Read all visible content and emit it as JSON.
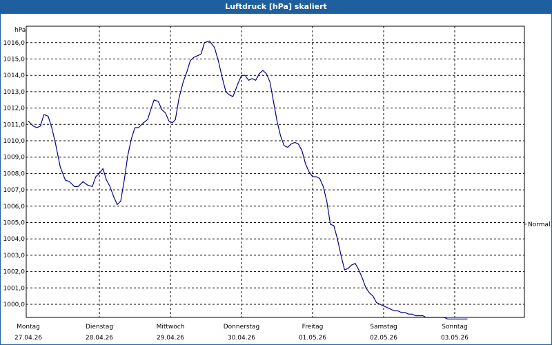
{
  "window": {
    "title": "Luftdruck [hPa] skaliert"
  },
  "chart_data": {
    "type": "line",
    "title": "Luftdruck [hPa] skaliert",
    "ylabel": "hPa",
    "xlabel": "",
    "ylim": [
      999.1,
      1016.6
    ],
    "xlim": [
      0,
      7
    ],
    "grid": true,
    "y_ticks": [
      "1000,0",
      "1001,0",
      "1002,0",
      "1003,0",
      "1004,0",
      "1005,0",
      "1006,0",
      "1007,0",
      "1008,0",
      "1009,0",
      "1010,0",
      "1011,0",
      "1012,0",
      "1013,0",
      "1014,0",
      "1015,0",
      "1016,0"
    ],
    "y_tick_values": [
      1000,
      1001,
      1002,
      1003,
      1004,
      1005,
      1006,
      1007,
      1008,
      1009,
      1010,
      1011,
      1012,
      1013,
      1014,
      1015,
      1016
    ],
    "x_ticks": [
      {
        "day": "Montag",
        "date": "27.04.26"
      },
      {
        "day": "Dienstag",
        "date": "28.04.26"
      },
      {
        "day": "Mittwoch",
        "date": "29.04.26"
      },
      {
        "day": "Donnerstag",
        "date": "30.04.26"
      },
      {
        "day": "Freitag",
        "date": "01.05.26"
      },
      {
        "day": "Samstag",
        "date": "02.05.26"
      },
      {
        "day": "Sonntag",
        "date": "03.05.26"
      }
    ],
    "reference_line": {
      "label": "Normal",
      "value": 1004.9
    },
    "colors": {
      "line": "#00008b",
      "grid": "#000000",
      "title_bar": "#1f5f9f"
    },
    "series": [
      {
        "x": [
          0.0,
          0.07,
          0.12,
          0.17,
          0.22,
          0.28,
          0.33,
          0.38,
          0.45,
          0.52,
          0.58,
          0.65,
          0.7,
          0.77,
          0.83,
          0.9,
          0.95,
          1.0,
          1.05,
          1.1,
          1.15,
          1.2,
          1.25,
          1.3,
          1.35,
          1.4,
          1.45,
          1.5,
          1.55,
          1.62,
          1.68,
          1.73,
          1.77,
          1.83,
          1.88,
          1.93,
          1.98,
          2.03,
          2.07,
          2.12,
          2.18,
          2.23,
          2.28,
          2.33,
          2.38,
          2.43,
          2.48,
          2.55,
          2.62,
          2.68,
          2.72,
          2.78,
          2.83,
          2.88,
          2.95,
          3.0,
          3.05,
          3.1,
          3.15,
          3.2,
          3.25,
          3.3,
          3.35,
          3.4,
          3.45,
          3.5,
          3.55,
          3.6,
          3.65,
          3.7,
          3.75,
          3.8,
          3.85,
          3.9,
          3.95,
          4.0,
          4.05,
          4.1,
          4.15,
          4.2,
          4.25,
          4.3,
          4.35,
          4.4,
          4.45,
          4.5,
          4.55,
          4.6,
          4.65,
          4.7,
          4.75,
          4.8,
          4.85,
          4.9,
          4.95,
          5.0,
          5.05,
          5.1,
          5.15,
          5.2,
          5.25,
          5.3,
          5.35,
          5.4,
          5.45,
          5.5,
          5.55,
          5.6,
          5.65,
          5.7,
          5.75,
          5.8,
          5.85,
          5.9,
          5.95,
          6.0,
          6.05,
          6.1,
          6.15,
          6.18
        ],
        "values": [
          1011.2,
          1010.9,
          1010.8,
          1010.9,
          1011.6,
          1011.5,
          1010.8,
          1009.9,
          1008.4,
          1007.6,
          1007.5,
          1007.2,
          1007.2,
          1007.5,
          1007.3,
          1007.2,
          1007.8,
          1008.0,
          1008.3,
          1007.6,
          1007.2,
          1006.6,
          1006.1,
          1006.3,
          1007.6,
          1009.1,
          1010.1,
          1010.8,
          1010.8,
          1011.1,
          1011.3,
          1012.0,
          1012.5,
          1012.4,
          1011.9,
          1011.7,
          1011.2,
          1011.1,
          1011.3,
          1012.6,
          1013.6,
          1014.2,
          1014.9,
          1015.1,
          1015.2,
          1015.3,
          1016.0,
          1016.1,
          1015.7,
          1014.8,
          1014.0,
          1013.0,
          1012.8,
          1012.7,
          1013.5,
          1014.0,
          1014.0,
          1013.7,
          1013.8,
          1013.7,
          1014.1,
          1014.3,
          1014.1,
          1013.6,
          1012.4,
          1011.2,
          1010.3,
          1009.7,
          1009.6,
          1009.8,
          1009.9,
          1009.8,
          1009.4,
          1008.6,
          1008.1,
          1007.8,
          1007.8,
          1007.7,
          1007.2,
          1006.3,
          1004.9,
          1004.8,
          1004.0,
          1003.0,
          1002.1,
          1002.2,
          1002.4,
          1002.5,
          1002.1,
          1001.6,
          1001.0,
          1000.7,
          1000.5,
          1000.1,
          1000.0,
          999.9,
          999.8,
          999.7,
          999.6,
          999.6,
          999.5,
          999.5,
          999.4,
          999.4,
          999.3,
          999.3,
          999.3,
          999.2,
          999.2,
          999.2,
          999.2,
          999.2,
          999.2,
          999.1,
          999.1,
          999.1,
          999.1,
          999.1,
          999.1,
          999.1
        ]
      }
    ]
  }
}
